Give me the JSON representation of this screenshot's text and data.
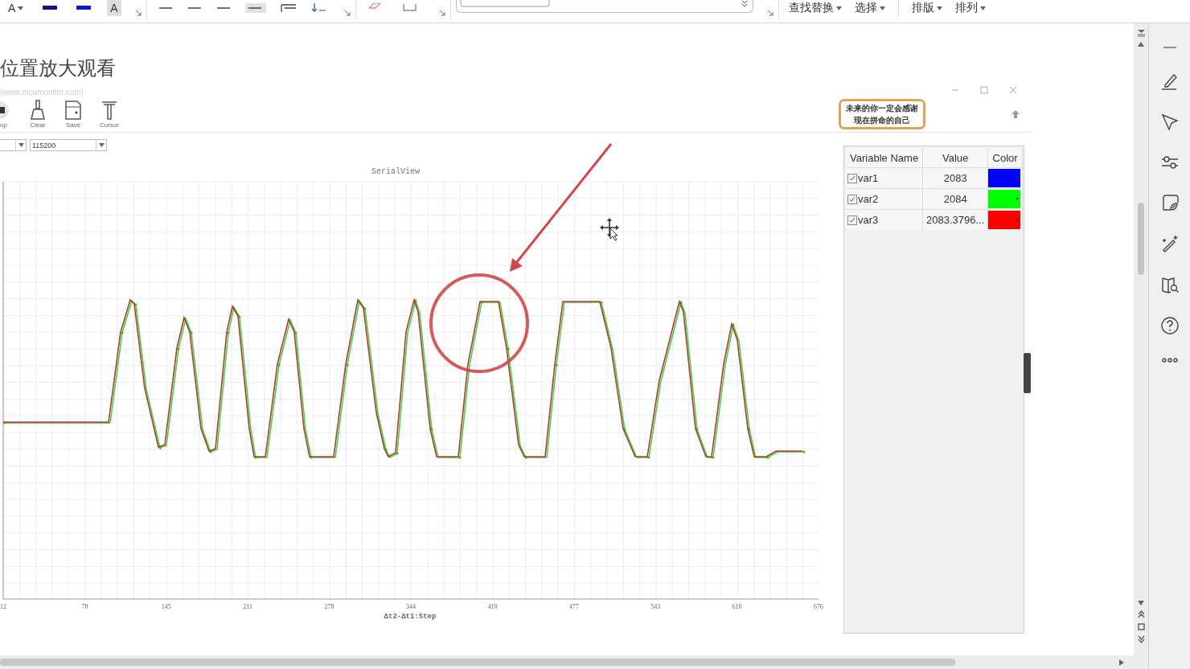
{
  "ribbon": {
    "font_letter": "A",
    "shaded_letter": "A",
    "commands": [
      "查找替换",
      "选择",
      "排版",
      "排列"
    ]
  },
  "document": {
    "heading": "位置放大观看",
    "subtitle": "(www.mcumonitor.com)"
  },
  "app": {
    "toolbar": [
      {
        "kind": "stop",
        "label": "op"
      },
      {
        "kind": "clear",
        "label": "Clear"
      },
      {
        "kind": "save",
        "label": "Save"
      },
      {
        "kind": "cursor",
        "label": "Cursor"
      }
    ],
    "motto": [
      "未来的你一定会感谢",
      "现在拼命的自己"
    ],
    "baud_rate": "115200",
    "chart": {
      "title": "SerialView",
      "x_tick_labels": [
        "12",
        "78",
        "145",
        "211",
        "278",
        "344",
        "410",
        "477",
        "543",
        "610",
        "676"
      ],
      "xlabel": "Δt2-Δt1:Step"
    },
    "table": {
      "columns": [
        "Variable Name",
        "Value",
        "Color"
      ],
      "variables": [
        {
          "name": "var1",
          "value": "2083",
          "checked": true,
          "color": "#0000ff"
        },
        {
          "name": "var2",
          "value": "2084",
          "checked": true,
          "color": "#00ff00"
        },
        {
          "name": "var3",
          "value": "2083.3796...",
          "checked": true,
          "color": "#ff0000"
        }
      ]
    }
  }
}
